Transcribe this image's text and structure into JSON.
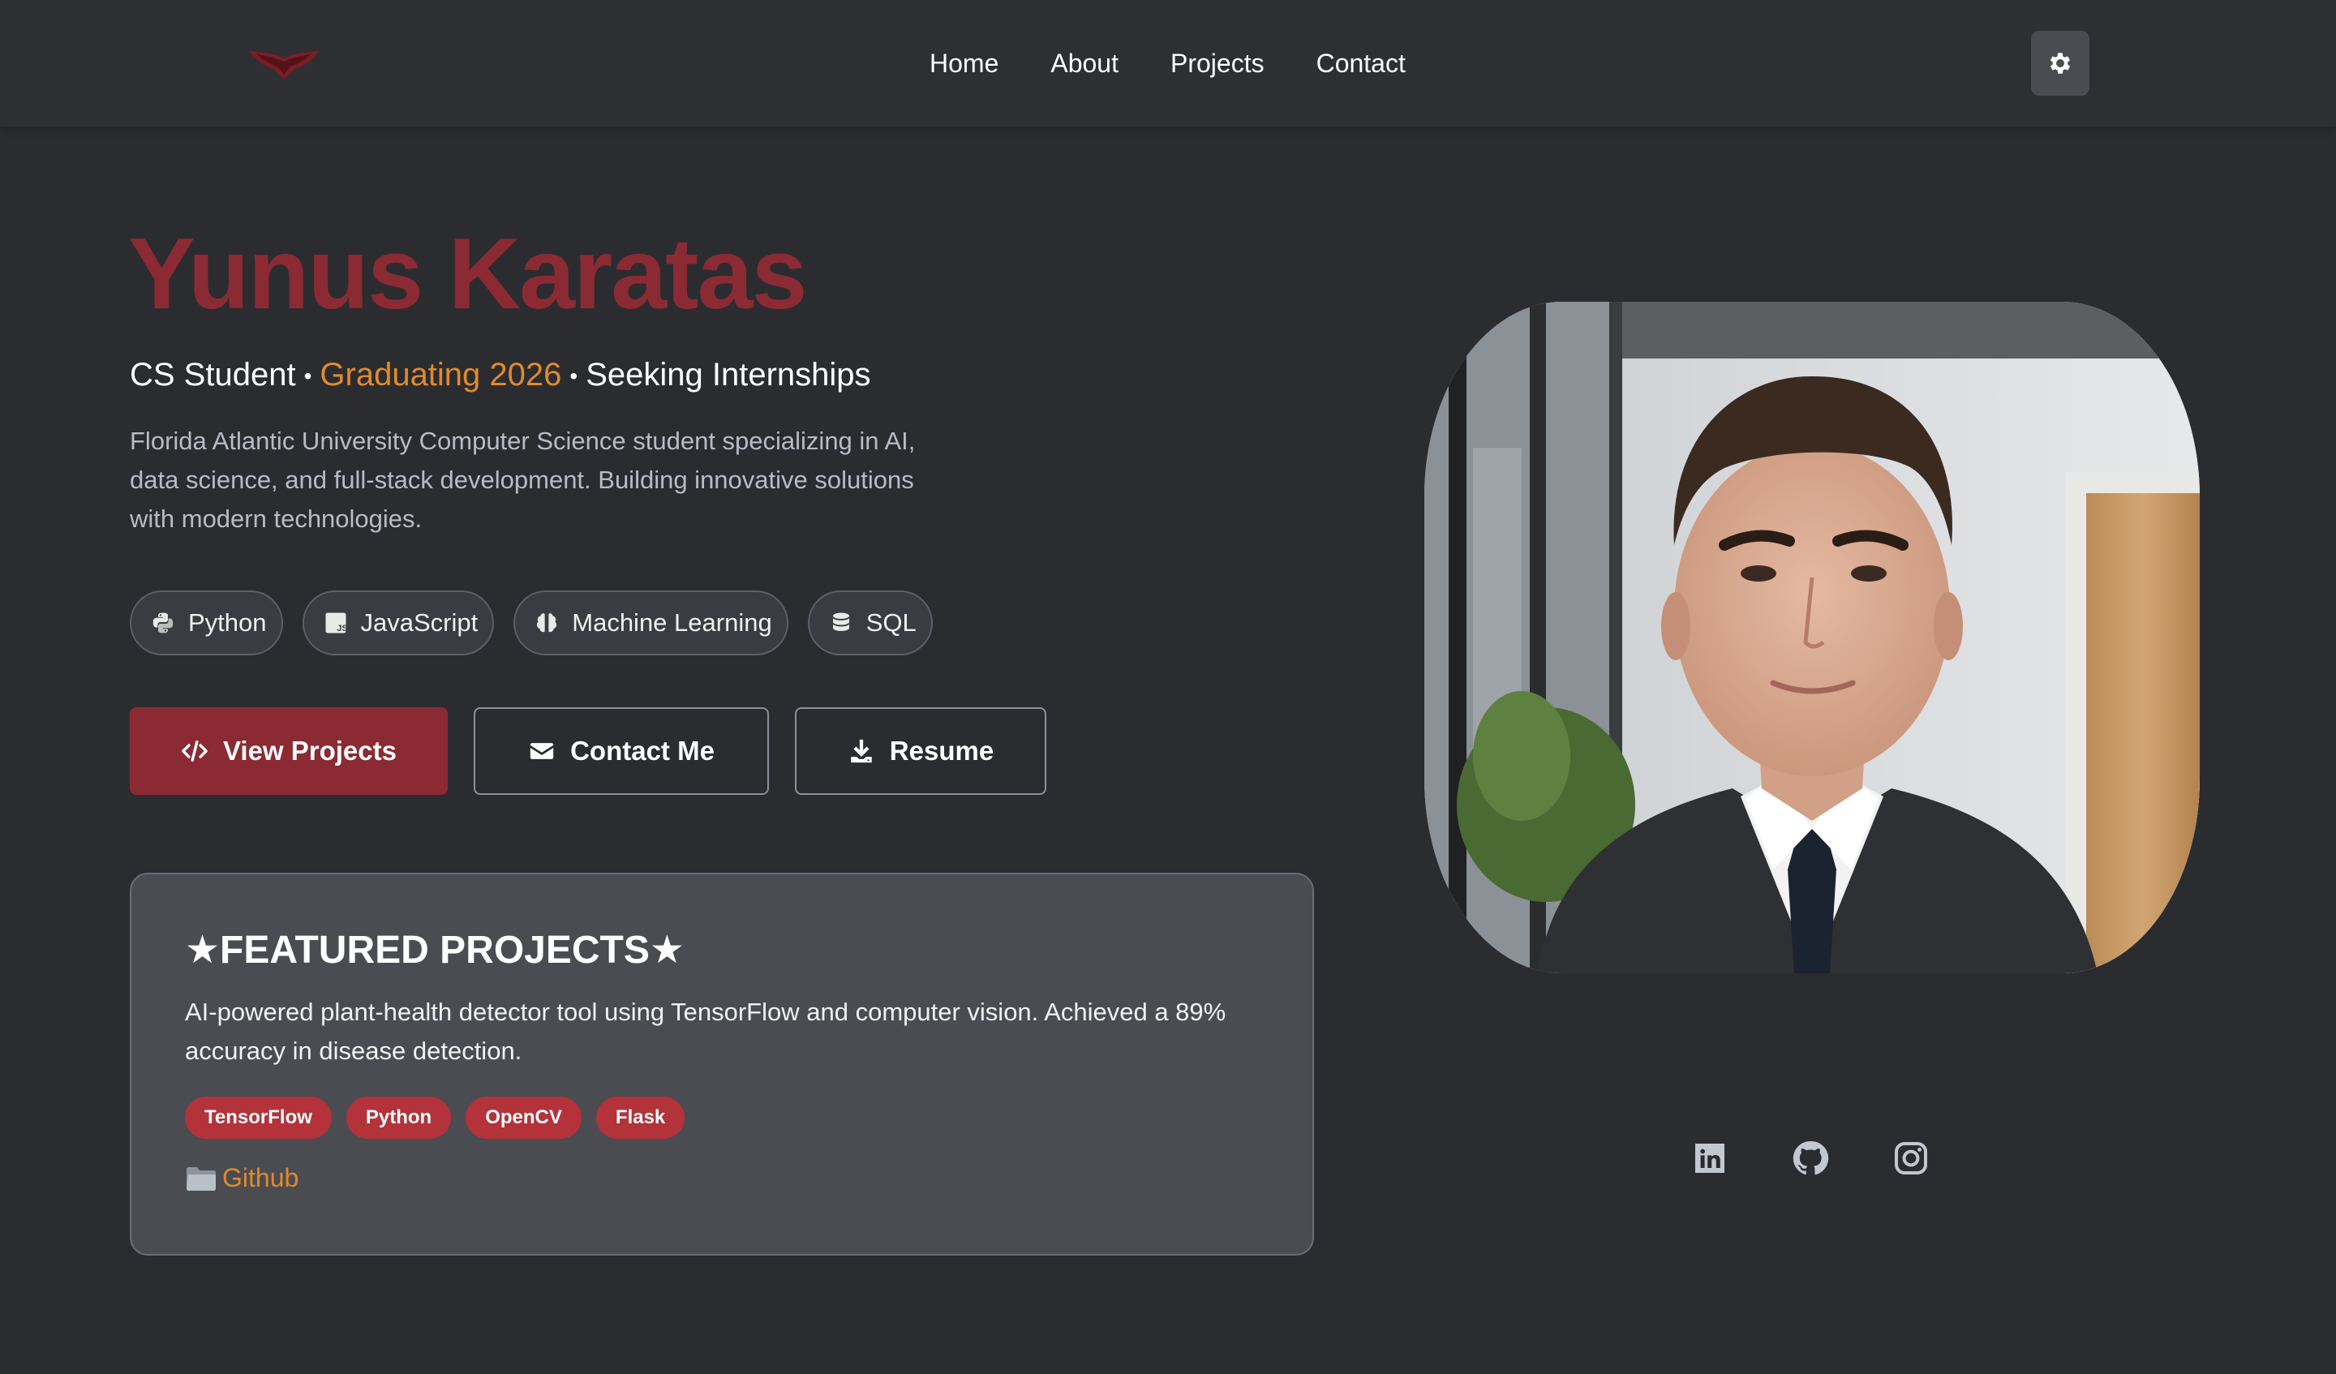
{
  "nav": {
    "logo_icon": "bat-wing-logo-icon",
    "links": [
      "Home",
      "About",
      "Projects",
      "Contact"
    ],
    "theme_toggle_icon": "gear-icon"
  },
  "hero": {
    "name": "Yunus Karatas",
    "tagline": {
      "role": "CS Student",
      "separator": "•",
      "graduation": "Graduating 2026",
      "seeking": "Seeking Internships"
    },
    "description": "Florida Atlantic University Computer Science student specializing in AI, data science, and full-stack development. Building innovative solutions with modern technologies.",
    "skills": [
      {
        "label": "Python",
        "icon": "python-icon"
      },
      {
        "label": "JavaScript",
        "icon": "javascript-icon"
      },
      {
        "label": "Machine Learning",
        "icon": "brain-icon"
      },
      {
        "label": "SQL",
        "icon": "database-icon"
      }
    ],
    "buttons": {
      "view_projects": "View Projects",
      "contact_me": "Contact Me",
      "resume": "Resume"
    }
  },
  "featured": {
    "title": "★FEATURED PROJECTS★",
    "description": "AI-powered plant-health detector tool using TensorFlow and computer vision. Achieved a 89% accuracy in disease detection.",
    "tags": [
      "TensorFlow",
      "Python",
      "OpenCV",
      "Flask"
    ],
    "link_label": "Github",
    "link_icon": "folder-icon"
  },
  "social": [
    "linkedin-icon",
    "github-icon",
    "instagram-icon"
  ],
  "colors": {
    "background": "#2b2c30",
    "brand": "#8b2a33",
    "accent": "#e08a2c",
    "tag": "#b4323a",
    "card": "#4a4c52"
  }
}
